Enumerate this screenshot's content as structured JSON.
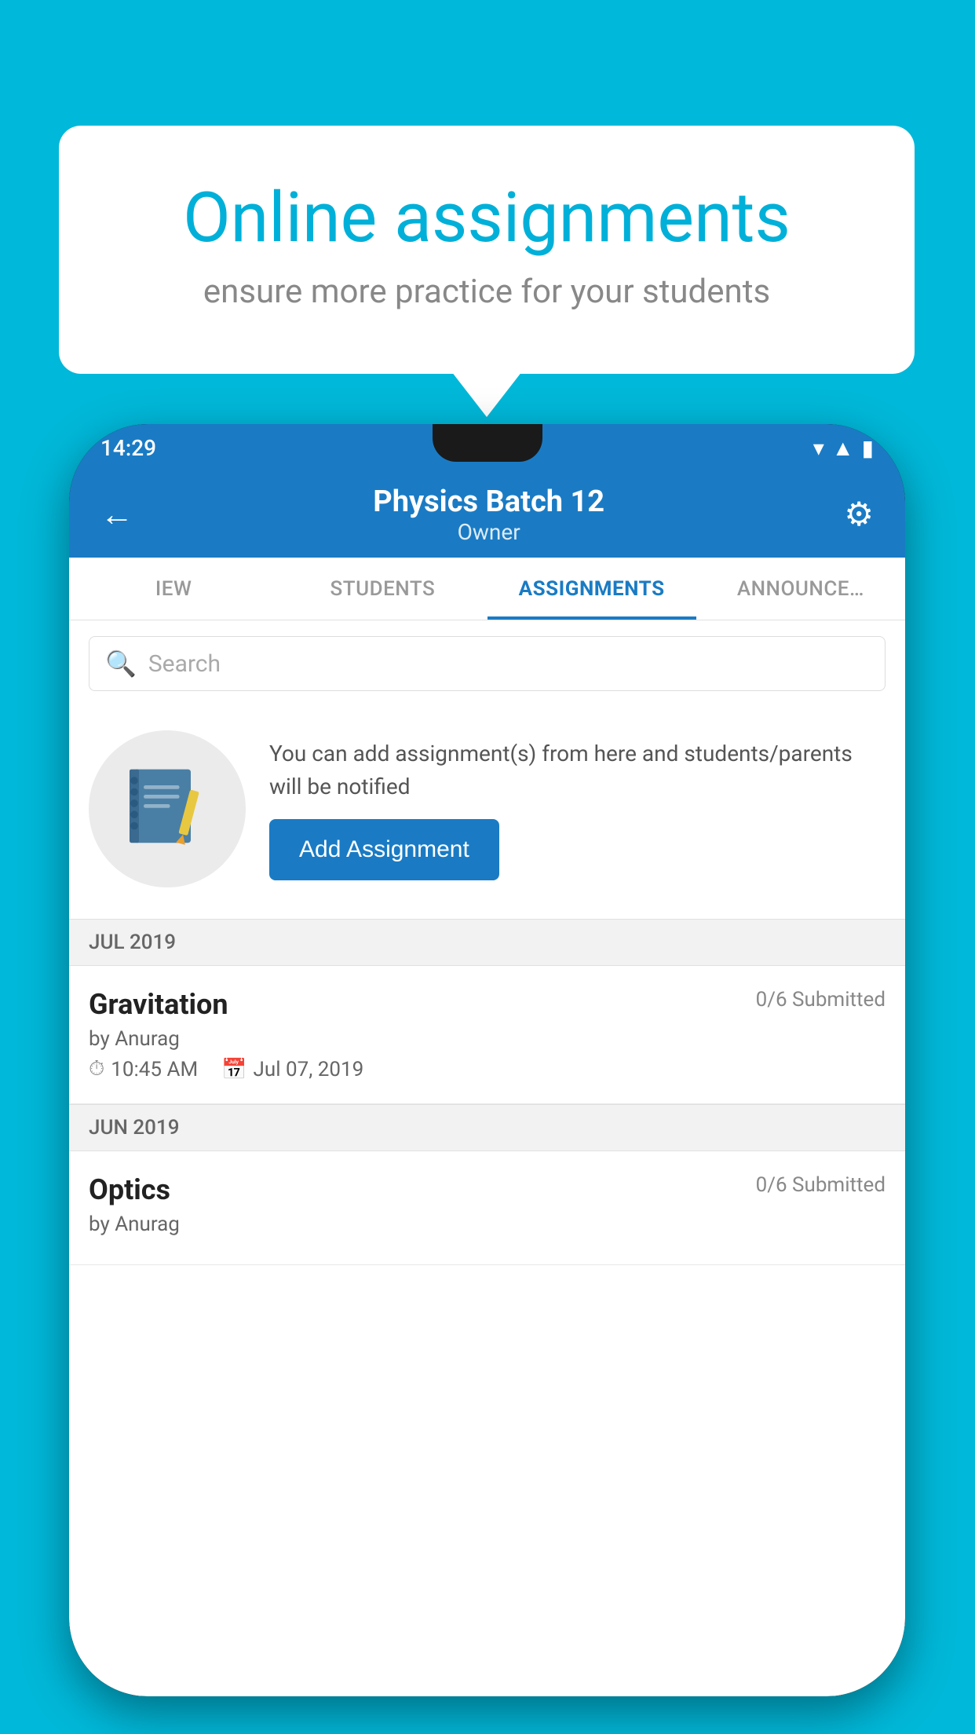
{
  "background": {
    "color": "#00B8D9"
  },
  "speech_bubble": {
    "title": "Online assignments",
    "subtitle": "ensure more practice for your students"
  },
  "phone": {
    "status_bar": {
      "time": "14:29"
    },
    "app_bar": {
      "title": "Physics Batch 12",
      "subtitle": "Owner",
      "back_label": "←",
      "settings_label": "⚙"
    },
    "tabs": [
      {
        "label": "IEW",
        "active": false
      },
      {
        "label": "STUDENTS",
        "active": false
      },
      {
        "label": "ASSIGNMENTS",
        "active": true
      },
      {
        "label": "ANNOUNCE…",
        "active": false
      }
    ],
    "search": {
      "placeholder": "Search"
    },
    "info_card": {
      "message": "You can add assignment(s) from here and students/parents will be notified",
      "add_button_label": "Add Assignment"
    },
    "sections": [
      {
        "month": "JUL 2019",
        "assignments": [
          {
            "title": "Gravitation",
            "submitted": "0/6 Submitted",
            "author": "by Anurag",
            "time": "10:45 AM",
            "date": "Jul 07, 2019"
          }
        ]
      },
      {
        "month": "JUN 2019",
        "assignments": [
          {
            "title": "Optics",
            "submitted": "0/6 Submitted",
            "author": "by Anurag",
            "time": "",
            "date": ""
          }
        ]
      }
    ]
  }
}
